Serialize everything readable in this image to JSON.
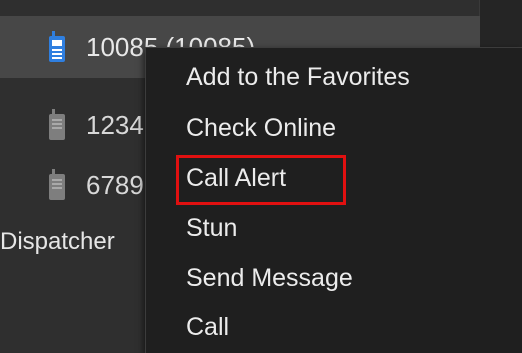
{
  "contacts": [
    {
      "label": "10085 (10085)",
      "status": "online",
      "icon": "walkie-talkie-icon",
      "color": "#2f7fe0"
    },
    {
      "label": "1234",
      "status": "offline",
      "icon": "walkie-talkie-icon",
      "color": "#8a8a8a"
    },
    {
      "label": "6789",
      "status": "offline",
      "icon": "walkie-talkie-icon",
      "color": "#8a8a8a"
    }
  ],
  "group": {
    "label": "Dispatcher"
  },
  "context_menu": {
    "items": [
      {
        "label": "Add to the Favorites"
      },
      {
        "label": "Check Online"
      },
      {
        "label": "Call Alert",
        "highlighted": true,
        "highlight_color": "#e01010"
      },
      {
        "label": "Stun"
      },
      {
        "label": "Send Message"
      },
      {
        "label": "Call"
      }
    ]
  }
}
